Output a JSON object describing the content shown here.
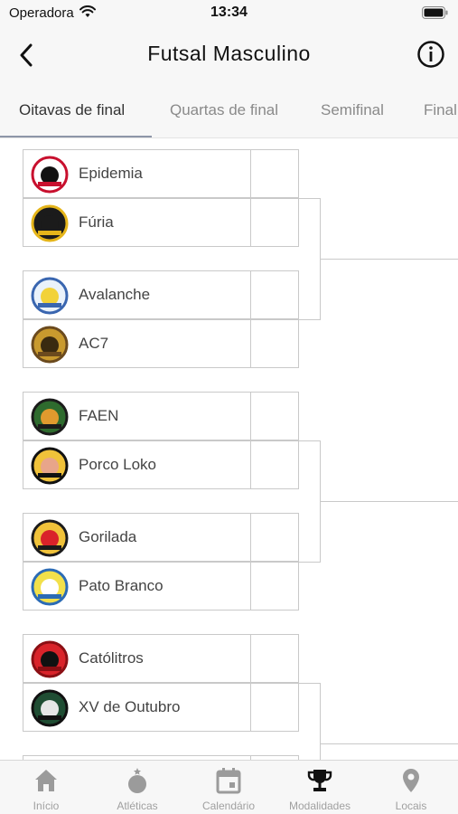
{
  "status_bar": {
    "carrier": "Operadora",
    "time": "13:34"
  },
  "nav": {
    "title": "Futsal Masculino",
    "back_icon": "chevron-left-icon",
    "info_icon": "info-icon"
  },
  "tabs": [
    {
      "label": "Oitavas de final",
      "active": true
    },
    {
      "label": "Quartas de final",
      "active": false
    },
    {
      "label": "Semifinal",
      "active": false
    },
    {
      "label": "Final",
      "active": false
    }
  ],
  "matches": [
    {
      "teams": [
        {
          "name": "Epidemia",
          "score": "",
          "logo": "epidemia"
        },
        {
          "name": "Fúria",
          "score": "",
          "logo": "furia"
        }
      ]
    },
    {
      "teams": [
        {
          "name": "Avalanche",
          "score": "",
          "logo": "avalanche"
        },
        {
          "name": "AC7",
          "score": "",
          "logo": "ac7"
        }
      ]
    },
    {
      "teams": [
        {
          "name": "FAEN",
          "score": "",
          "logo": "faen"
        },
        {
          "name": "Porco Loko",
          "score": "",
          "logo": "porco-loko"
        }
      ]
    },
    {
      "teams": [
        {
          "name": "Gorilada",
          "score": "",
          "logo": "gorilada"
        },
        {
          "name": "Pato Branco",
          "score": "",
          "logo": "pato-branco"
        }
      ]
    },
    {
      "teams": [
        {
          "name": "Católitros",
          "score": "",
          "logo": "catolitros"
        },
        {
          "name": "XV de Outubro",
          "score": "",
          "logo": "xv-de-outubro"
        }
      ]
    }
  ],
  "bottom_tabs": [
    {
      "label": "Início",
      "icon": "home-icon",
      "active": false
    },
    {
      "label": "Atléticas",
      "icon": "medal-icon",
      "active": false
    },
    {
      "label": "Calendário",
      "icon": "calendar-icon",
      "active": false
    },
    {
      "label": "Modalidades",
      "icon": "trophy-icon",
      "active": true
    },
    {
      "label": "Locais",
      "icon": "location-pin-icon",
      "active": false
    }
  ]
}
